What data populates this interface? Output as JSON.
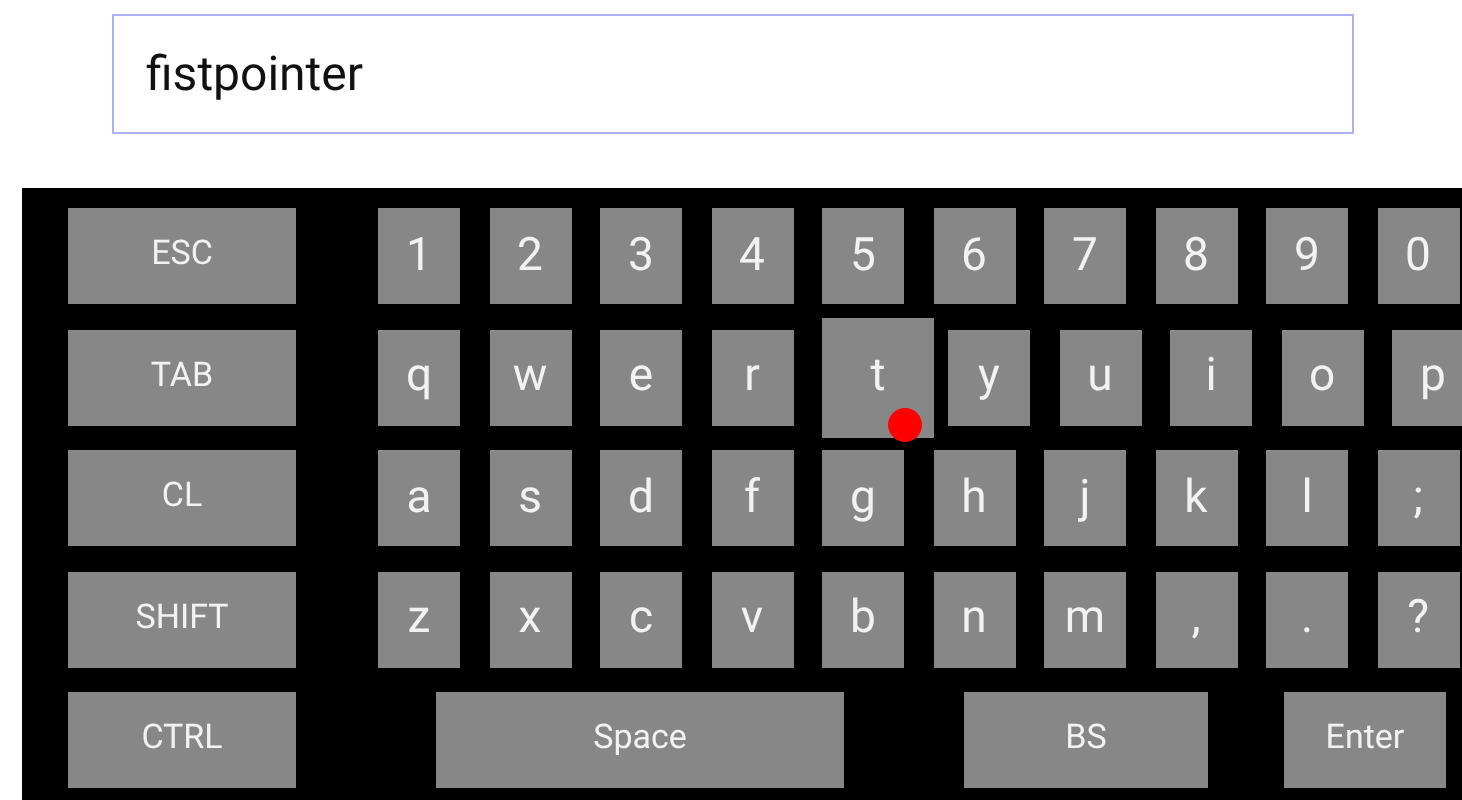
{
  "text_field": {
    "value": "fistpointer"
  },
  "keyboard": {
    "rows": [
      {
        "keys": [
          {
            "label": "ESC",
            "kind": "modifier",
            "pressed": false
          },
          {
            "label": "1",
            "kind": "char",
            "pressed": false
          },
          {
            "label": "2",
            "kind": "char",
            "pressed": false
          },
          {
            "label": "3",
            "kind": "char",
            "pressed": false
          },
          {
            "label": "4",
            "kind": "char",
            "pressed": false
          },
          {
            "label": "5",
            "kind": "char",
            "pressed": false
          },
          {
            "label": "6",
            "kind": "char",
            "pressed": false
          },
          {
            "label": "7",
            "kind": "char",
            "pressed": false
          },
          {
            "label": "8",
            "kind": "char",
            "pressed": false
          },
          {
            "label": "9",
            "kind": "char",
            "pressed": false
          },
          {
            "label": "0",
            "kind": "char",
            "pressed": false
          }
        ]
      },
      {
        "keys": [
          {
            "label": "TAB",
            "kind": "modifier",
            "pressed": false
          },
          {
            "label": "q",
            "kind": "char",
            "pressed": false
          },
          {
            "label": "w",
            "kind": "char",
            "pressed": false
          },
          {
            "label": "e",
            "kind": "char",
            "pressed": false
          },
          {
            "label": "r",
            "kind": "char",
            "pressed": false
          },
          {
            "label": "t",
            "kind": "char",
            "pressed": true
          },
          {
            "label": "y",
            "kind": "char",
            "pressed": false
          },
          {
            "label": "u",
            "kind": "char",
            "pressed": false
          },
          {
            "label": "i",
            "kind": "char",
            "pressed": false
          },
          {
            "label": "o",
            "kind": "char",
            "pressed": false
          },
          {
            "label": "p",
            "kind": "char",
            "pressed": false
          }
        ]
      },
      {
        "keys": [
          {
            "label": "CL",
            "kind": "modifier",
            "pressed": false
          },
          {
            "label": "a",
            "kind": "char",
            "pressed": false
          },
          {
            "label": "s",
            "kind": "char",
            "pressed": false
          },
          {
            "label": "d",
            "kind": "char",
            "pressed": false
          },
          {
            "label": "f",
            "kind": "char",
            "pressed": false
          },
          {
            "label": "g",
            "kind": "char",
            "pressed": false
          },
          {
            "label": "h",
            "kind": "char",
            "pressed": false
          },
          {
            "label": "j",
            "kind": "char",
            "pressed": false
          },
          {
            "label": "k",
            "kind": "char",
            "pressed": false
          },
          {
            "label": "l",
            "kind": "char",
            "pressed": false
          },
          {
            "label": ";",
            "kind": "char",
            "pressed": false
          }
        ]
      },
      {
        "keys": [
          {
            "label": "SHIFT",
            "kind": "modifier",
            "pressed": false
          },
          {
            "label": "z",
            "kind": "char",
            "pressed": false
          },
          {
            "label": "x",
            "kind": "char",
            "pressed": false
          },
          {
            "label": "c",
            "kind": "char",
            "pressed": false
          },
          {
            "label": "v",
            "kind": "char",
            "pressed": false
          },
          {
            "label": "b",
            "kind": "char",
            "pressed": false
          },
          {
            "label": "n",
            "kind": "char",
            "pressed": false
          },
          {
            "label": "m",
            "kind": "char",
            "pressed": false
          },
          {
            "label": ",",
            "kind": "char",
            "pressed": false
          },
          {
            "label": ".",
            "kind": "char",
            "pressed": false
          },
          {
            "label": "?",
            "kind": "char",
            "pressed": false
          }
        ]
      },
      {
        "keys": [
          {
            "label": "CTRL",
            "kind": "modifier",
            "pressed": false
          },
          {
            "label": "Space",
            "kind": "space",
            "pressed": false
          },
          {
            "label": "BS",
            "kind": "backspace",
            "pressed": false
          },
          {
            "label": "Enter",
            "kind": "enter",
            "pressed": false
          }
        ]
      }
    ]
  }
}
